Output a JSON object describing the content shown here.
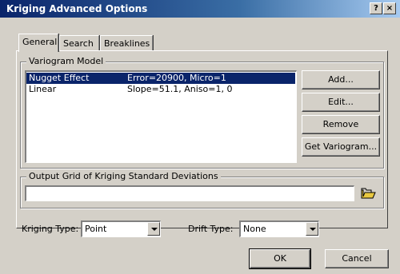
{
  "window": {
    "title": "Kriging Advanced Options",
    "help_label": "?",
    "close_label": "×"
  },
  "tabs": [
    {
      "label": "General",
      "active": true
    },
    {
      "label": "Search",
      "active": false
    },
    {
      "label": "Breaklines",
      "active": false
    }
  ],
  "variogram": {
    "group_label": "Variogram Model",
    "rows": [
      {
        "name": "Nugget Effect",
        "params": "Error=20900, Micro=1",
        "selected": true
      },
      {
        "name": "Linear",
        "params": "Slope=51.1, Aniso=1, 0",
        "selected": false
      }
    ],
    "buttons": {
      "add": "Add...",
      "edit": "Edit...",
      "remove": "Remove",
      "get": "Get Variogram..."
    }
  },
  "output_grid": {
    "group_label": "Output Grid of Kriging Standard Deviations",
    "value": "",
    "browse_icon": "folder-open-icon"
  },
  "kriging_type": {
    "label": "Kriging Type:",
    "value": "Point"
  },
  "drift_type": {
    "label": "Drift Type:",
    "value": "None"
  },
  "footer": {
    "ok": "OK",
    "cancel": "Cancel"
  },
  "colors": {
    "titlebar": "#0a246a",
    "selection": "#0a246a",
    "face": "#d4d0c8"
  }
}
